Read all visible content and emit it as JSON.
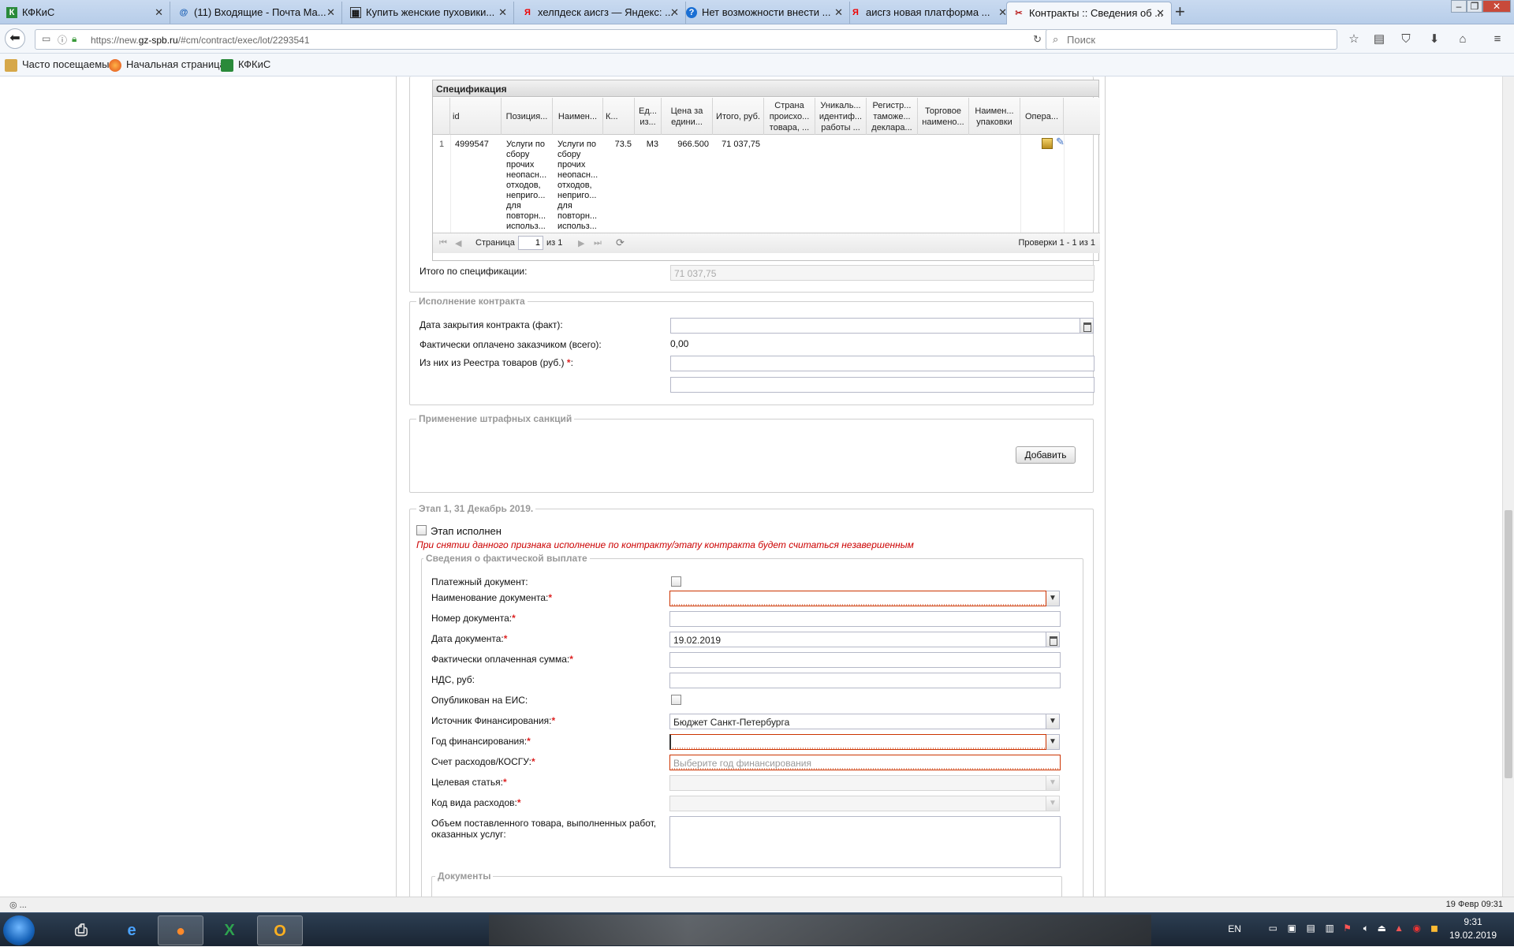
{
  "tabs": [
    {
      "title": "КФКиС",
      "icon": "kfkis-icon"
    },
    {
      "title": "(11) Входящие - Почта Ma...",
      "icon": "mail-icon"
    },
    {
      "title": "Купить женские пуховики...",
      "icon": "shop-icon"
    },
    {
      "title": "хелпдеск аисгз — Яндекс: ...",
      "icon": "yandex-icon"
    },
    {
      "title": "Нет возможности внести ...",
      "icon": "help-icon"
    },
    {
      "title": "аисгз новая платформа ...",
      "icon": "yandex-icon"
    },
    {
      "title": "Контракты :: Сведения об ...",
      "icon": "tools-icon"
    }
  ],
  "nav": {
    "url_prefix": "https://new.",
    "url_domain": "gz-spb.ru",
    "url_path": "/#cm/contract/exec/lot/2293541",
    "search_placeholder": "Поиск"
  },
  "bookmarks": [
    "Часто посещаемые",
    "Начальная страница",
    "КФКиС"
  ],
  "spec": {
    "title": "Спецификация",
    "columns": [
      "",
      "id",
      "Позиция...",
      "Наимен...",
      "К...",
      "Ед... из...",
      "Цена за едини...",
      "Итого, руб.",
      "Страна происхо... товара, ...",
      "Уникаль... идентиф... работы ...",
      "Регистр... таможе... деклара...",
      "Торговое наимено...",
      "Наимен... упаковки",
      "Опера..."
    ],
    "rows": [
      {
        "num": "1",
        "id": "4999547",
        "position": "Услуги по сбору прочих неопасн... отходов, неприго... для повторн... использ...",
        "name": "Услуги по сбору прочих неопасн... отходов, неприго... для повторн... использ...",
        "qty": "73.5",
        "unit": "M3",
        "price": "966.500",
        "total": "71 037,75"
      }
    ],
    "pager": {
      "page_label": "Страница",
      "page": "1",
      "of": "из 1",
      "checks": "Проверки 1 - 1 из 1"
    },
    "total_label": "Итого по спецификации:",
    "total_value": "71 037,75"
  },
  "execution": {
    "legend": "Исполнение контракта",
    "close_date_label": "Дата закрытия контракта (факт):",
    "paid_label": "Фактически оплачено заказчиком (всего):",
    "paid_value": "0,00",
    "registry_label": "Из них из Реестра товаров (руб.)",
    "required_mark": "*",
    "colon": ":"
  },
  "penalties": {
    "legend": "Применение штрафных санкций",
    "add_button": "Добавить"
  },
  "stage": {
    "legend": "Этап 1, 31 Декабрь 2019.",
    "done_label": "Этап исполнен",
    "warning": "При снятии данного признака исполнение по контракту/этапу контракта будет считаться незавершенным",
    "payment_legend": "Сведения о фактической выплате",
    "fields": {
      "payment_doc": "Платежный документ:",
      "doc_name": "Наименование документа:",
      "doc_number": "Номер документа:",
      "doc_date": "Дата документа:",
      "doc_date_value": "19.02.2019",
      "paid_sum": "Фактически оплаченная сумма:",
      "vat": "НДС, руб:",
      "published": "Опубликован на ЕИС:",
      "source": "Источник Финансирования:",
      "source_value": "Бюджет Санкт-Петербурга",
      "year": "Год финансирования:",
      "account": "Счет расходов/КОСГУ:",
      "account_placeholder": "Выберите год финансирования",
      "article": "Целевая статья:",
      "expense_code": "Код вида расходов:",
      "volume": "Объем поставленного товара, выполненных работ, оказанных услуг:"
    },
    "documents_legend": "Документы"
  },
  "status": {
    "left": "◎ ...",
    "right": "19 Февр 09:31"
  },
  "taskbar": {
    "lang": "EN",
    "time": "9:31",
    "date": "19.02.2019"
  },
  "colors": {
    "required": "#dd2222",
    "warning": "#cc0000",
    "legend": "#999999"
  }
}
